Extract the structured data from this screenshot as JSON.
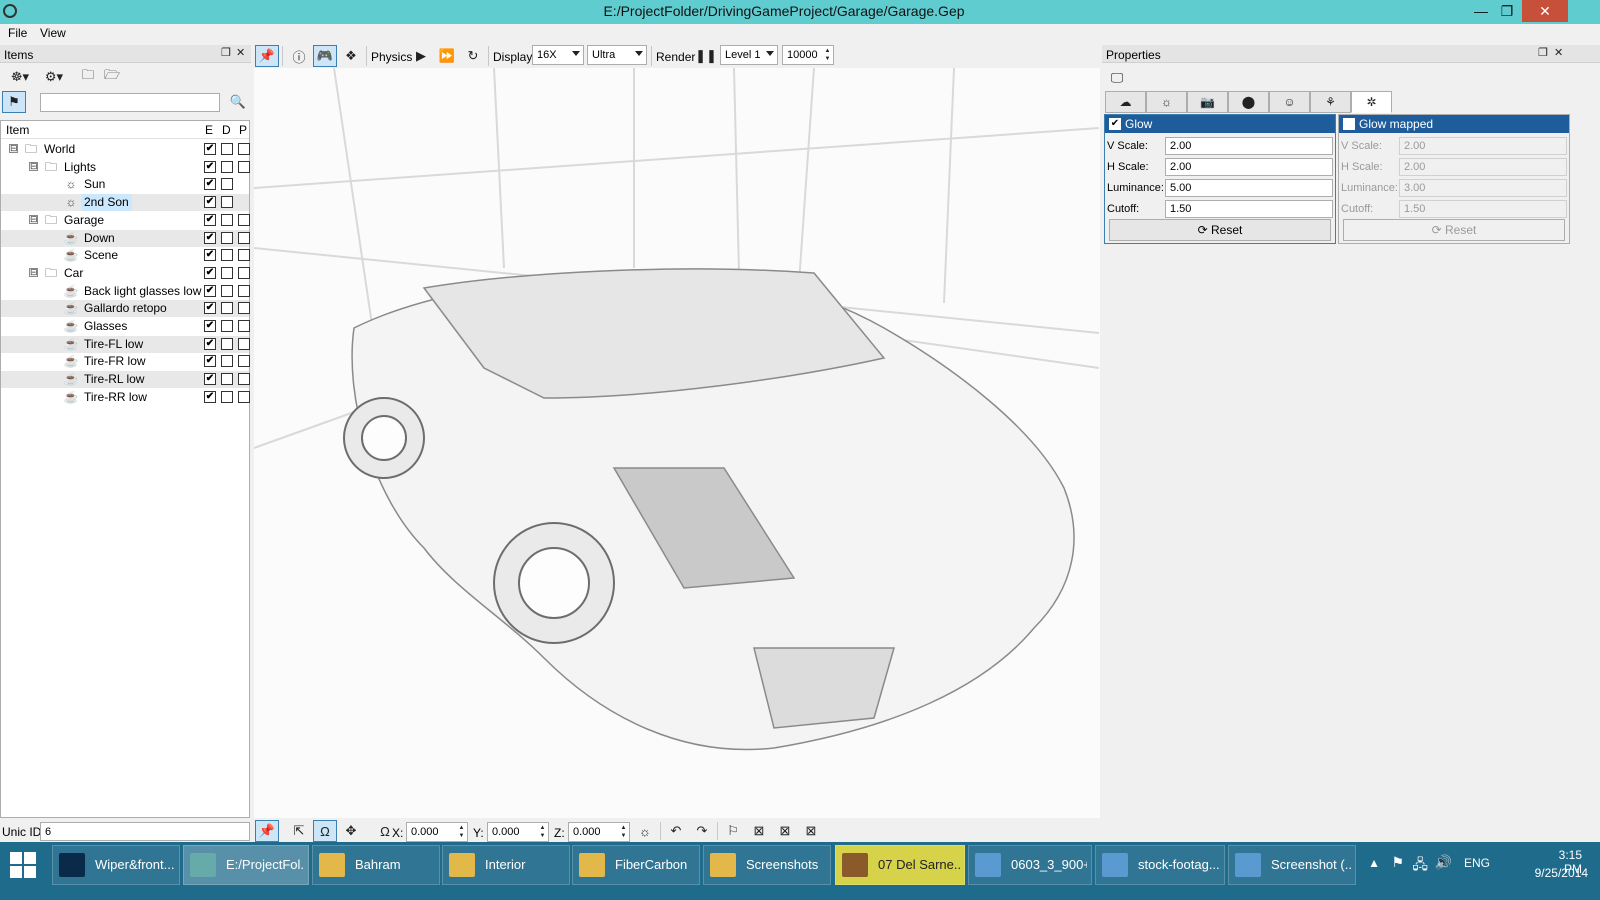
{
  "window": {
    "title": "E:/ProjectFolder/DrivingGameProject/Garage/Garage.Gep",
    "minimize": "—",
    "maximize": "❐",
    "close": "✕"
  },
  "menu": {
    "file": "File",
    "view": "View"
  },
  "items_panel": {
    "title": "Items",
    "float_btn": "❐",
    "close_btn": "✕",
    "search_value": "",
    "columns": {
      "item": "Item",
      "e": "E",
      "d": "D",
      "p": "P"
    },
    "rows": [
      {
        "label": "World",
        "icon": "folder-icon",
        "level": 0,
        "expander": "⊟",
        "e": true,
        "d": false,
        "p": false
      },
      {
        "label": "Lights",
        "icon": "folder-icon",
        "level": 1,
        "expander": "⊟",
        "e": true,
        "d": false,
        "p": false
      },
      {
        "label": "Sun",
        "icon": "sun-icon",
        "level": 2,
        "expander": "",
        "e": true,
        "d": false,
        "p": null
      },
      {
        "label": "2nd Son",
        "icon": "sun-icon",
        "level": 2,
        "expander": "",
        "e": true,
        "d": false,
        "p": null,
        "selected": true
      },
      {
        "label": "Garage",
        "icon": "folder-icon",
        "level": 1,
        "expander": "⊟",
        "e": true,
        "d": false,
        "p": false
      },
      {
        "label": "Down",
        "icon": "teapot-icon",
        "level": 2,
        "expander": "",
        "e": true,
        "d": false,
        "p": false
      },
      {
        "label": "Scene",
        "icon": "teapot-icon",
        "level": 2,
        "expander": "",
        "e": true,
        "d": false,
        "p": false
      },
      {
        "label": "Car",
        "icon": "folder-icon",
        "level": 1,
        "expander": "⊟",
        "e": true,
        "d": false,
        "p": false
      },
      {
        "label": "Back light glasses low",
        "icon": "teapot-icon",
        "level": 2,
        "expander": "",
        "e": true,
        "d": false,
        "p": false
      },
      {
        "label": "Gallardo retopo",
        "icon": "teapot-icon",
        "level": 2,
        "expander": "",
        "e": true,
        "d": false,
        "p": false
      },
      {
        "label": "Glasses",
        "icon": "teapot-icon",
        "level": 2,
        "expander": "",
        "e": true,
        "d": false,
        "p": false
      },
      {
        "label": "Tire-FL low",
        "icon": "teapot-icon",
        "level": 2,
        "expander": "",
        "e": true,
        "d": false,
        "p": false
      },
      {
        "label": "Tire-FR low",
        "icon": "teapot-icon",
        "level": 2,
        "expander": "",
        "e": true,
        "d": false,
        "p": false
      },
      {
        "label": "Tire-RL low",
        "icon": "teapot-icon",
        "level": 2,
        "expander": "",
        "e": true,
        "d": false,
        "p": false
      },
      {
        "label": "Tire-RR low",
        "icon": "teapot-icon",
        "level": 2,
        "expander": "",
        "e": true,
        "d": false,
        "p": false
      }
    ],
    "unic_id_label": "Unic ID:",
    "unic_id_value": "6"
  },
  "toolbar": {
    "physics_label": "Physics",
    "display_label": "Display",
    "display_value": "16X",
    "quality_value": "Ultra",
    "render_label": "Render",
    "level_value": "Level 1",
    "count_value": "10000"
  },
  "bottom_toolbar": {
    "x_label": "X:",
    "x_value": "0.000",
    "y_label": "Y:",
    "y_value": "0.000",
    "z_label": "Z:",
    "z_value": "0.000"
  },
  "properties": {
    "title": "Properties",
    "float_btn": "❐",
    "close_btn": "✕",
    "glow": {
      "title": "Glow",
      "checked": true,
      "fields": [
        {
          "label": "V Scale:",
          "value": "2.00"
        },
        {
          "label": "H Scale:",
          "value": "2.00"
        },
        {
          "label": "Luminance:",
          "value": "5.00"
        },
        {
          "label": "Cutoff:",
          "value": "1.50"
        }
      ],
      "reset": "Reset"
    },
    "glow_mapped": {
      "title": "Glow mapped",
      "checked": false,
      "fields": [
        {
          "label": "V Scale:",
          "value": "2.00"
        },
        {
          "label": "H Scale:",
          "value": "2.00"
        },
        {
          "label": "Luminance:",
          "value": "3.00"
        },
        {
          "label": "Cutoff:",
          "value": "1.50"
        }
      ],
      "reset": "Reset"
    }
  },
  "taskbar": {
    "items": [
      {
        "label": "Wiper&front...",
        "icon": "photoshop-icon"
      },
      {
        "label": "E:/ProjectFol...",
        "icon": "app-icon"
      },
      {
        "label": "Bahram",
        "icon": "folder-icon"
      },
      {
        "label": "Interior",
        "icon": "folder-icon"
      },
      {
        "label": "FiberCarbon",
        "icon": "folder-icon"
      },
      {
        "label": "Screenshots",
        "icon": "folder-icon"
      },
      {
        "label": "07 Del Sarne...",
        "icon": "media-icon"
      },
      {
        "label": "0603_3_900+...",
        "icon": "image-icon"
      },
      {
        "label": "stock-footag...",
        "icon": "image-icon"
      },
      {
        "label": "Screenshot (...",
        "icon": "image-icon"
      }
    ],
    "lang": "ENG",
    "time": "3:15 PM",
    "date": "9/25/2014"
  }
}
